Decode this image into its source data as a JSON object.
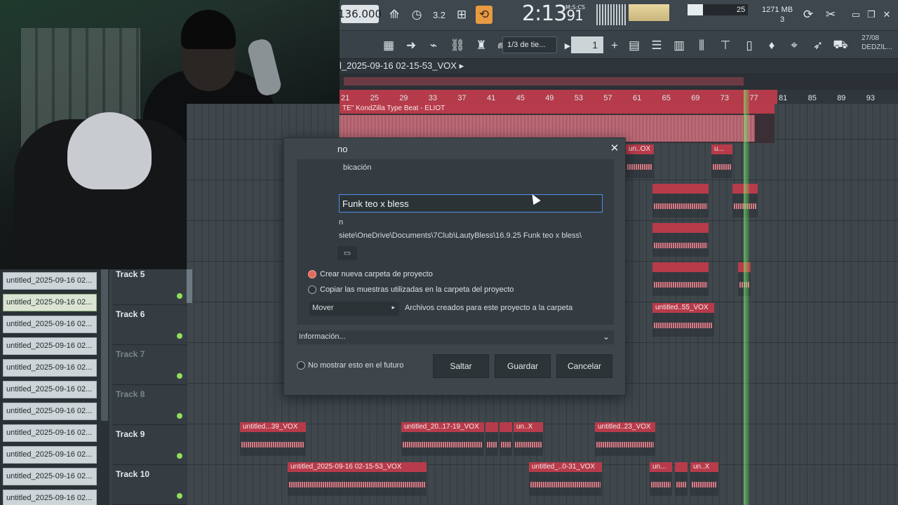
{
  "toolbar": {
    "tempo": "136.000",
    "clock_time": "2:13",
    "clock_sub": "91",
    "clock_unit": "M:S:CS",
    "cpu_value": "25",
    "memory": "1271 MB",
    "polyphony": "3",
    "snap_hint": "1/3 de tie...",
    "snap_value": "1",
    "date_line1": "27/08",
    "date_line2": "DEDZIL..."
  },
  "playlist": {
    "title": "l_2025-09-16 02-15-53_VOX",
    "ruler_marks": [
      "21",
      "25",
      "29",
      "33",
      "37",
      "41",
      "45",
      "49",
      "53",
      "57",
      "61",
      "65",
      "69",
      "73",
      "77",
      "81",
      "85",
      "89",
      "93"
    ],
    "big_clip_label": "TE\" KondZilla Type Beat - ELIOT"
  },
  "tracks": [
    {
      "label": "Track 5",
      "dim": false
    },
    {
      "label": "Track 6",
      "dim": false
    },
    {
      "label": "Track 7",
      "dim": true
    },
    {
      "label": "Track 8",
      "dim": true
    },
    {
      "label": "Track 9",
      "dim": false
    },
    {
      "label": "Track 10",
      "dim": false
    }
  ],
  "clips": {
    "c1": "un..OX",
    "c2": "u...",
    "c3": "untitled..55_VOX",
    "c4": "untitled...39_VOX",
    "c5": "untitled_20..17-19_VOX",
    "c6": "un..X",
    "c7": "untitled..23_VOX",
    "c8": "untitled_2025-09-16 02-15-53_VOX",
    "c9": "untitled_..0-31_VOX",
    "c10": "un...",
    "c11": "un..X"
  },
  "browser": {
    "items": [
      "untitled_2025-09-16 02...",
      "untitled_2025-09-16 02...",
      "untitled_2025-09-16 02...",
      "untitled_2025-09-16 02...",
      "untitled_2025-09-16 02...",
      "untitled_2025-09-16 02...",
      "untitled_2025-09-16 02...",
      "untitled_2025-09-16 02...",
      "untitled_2025-09-16 02...",
      "untitled_2025-09-16 02...",
      "untitled_2025-09-16 02..."
    ]
  },
  "dialog": {
    "title": "no",
    "location_label": "bicación",
    "name_value": "Funk teo x bless",
    "path_label": "n",
    "path_value": "siete\\OneDrive\\Documents\\7Club\\LautyBless\\16.9.25 Funk teo x bless\\",
    "opt_create_folder": "Crear nueva carpeta de proyecto",
    "opt_copy_samples": "Copiar las muestras utilizadas en la carpeta del proyecto",
    "mover_label": "Mover",
    "mover_desc": "Archivos creados para este proyecto a la carpeta",
    "info_label": "Información...",
    "dont_show": "No mostrar esto en el futuro",
    "btn_skip": "Saltar",
    "btn_save": "Guardar",
    "btn_cancel": "Cancelar"
  },
  "colors": {
    "accent_clip": "#b73b4a",
    "playhead": "#7bff6e",
    "input_focus": "#4f8ee8"
  }
}
